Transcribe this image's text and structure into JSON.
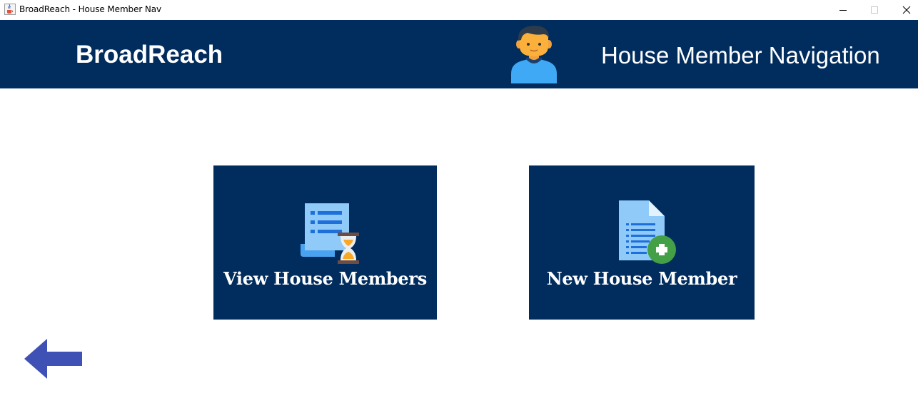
{
  "window": {
    "title": "BroadReach - House Member Nav",
    "icon": "java-cup-icon",
    "controls": [
      "minimize",
      "maximize",
      "close"
    ]
  },
  "header": {
    "brand": "BroadReach",
    "avatar_icon": "user-avatar-icon",
    "title": "House Member Navigation",
    "background": "#002c5e"
  },
  "tiles": [
    {
      "label": "View House Members",
      "icon": "document-list-hourglass-icon"
    },
    {
      "label": "New House Member",
      "icon": "document-add-icon"
    }
  ],
  "back": {
    "icon": "back-arrow-icon",
    "color": "#3f51b5"
  }
}
